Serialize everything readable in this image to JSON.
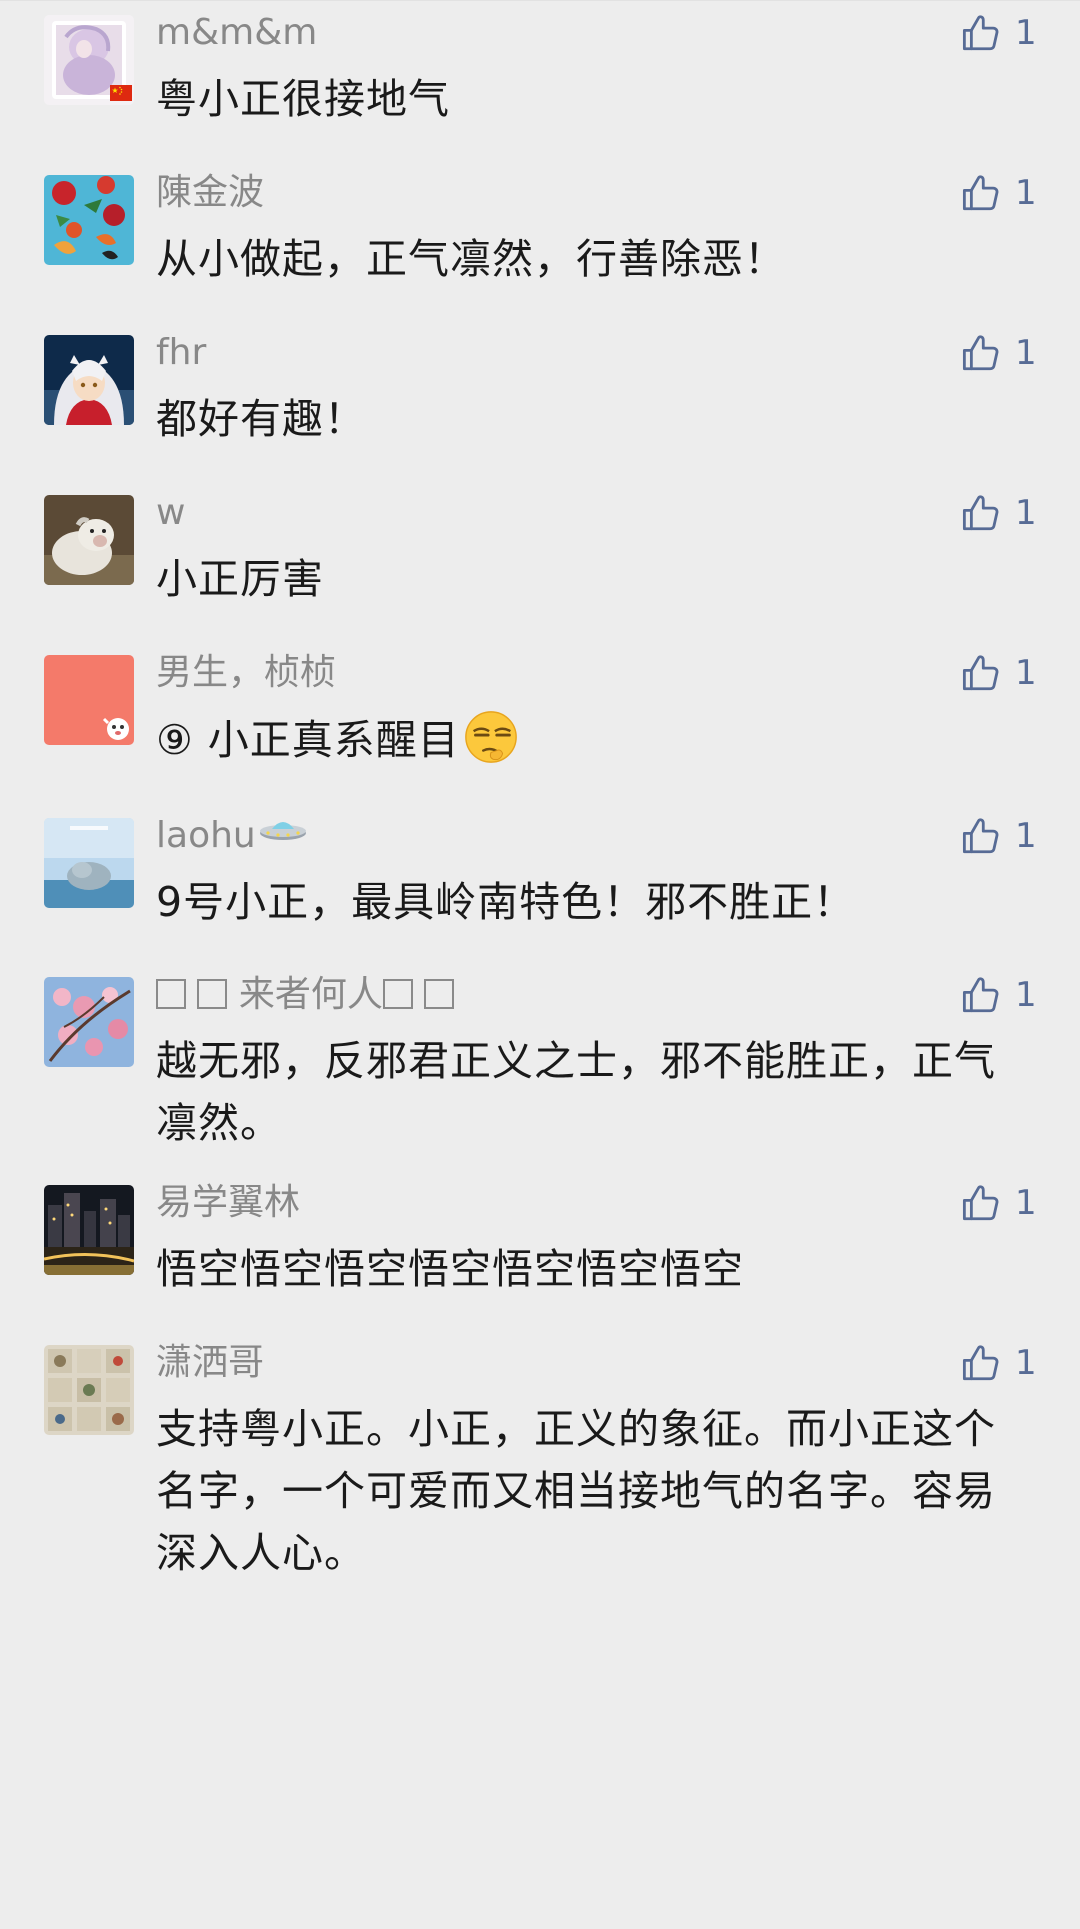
{
  "comments": [
    {
      "name": "m&m&m",
      "text": "粤小正很接地气",
      "likes": "1"
    },
    {
      "name": "陳金波",
      "text": "从小做起，正气凛然，行善除恶！",
      "likes": "1"
    },
    {
      "name": "fhr",
      "text": "都好有趣！",
      "likes": "1"
    },
    {
      "name": "w",
      "text": "小正厉害",
      "likes": "1"
    },
    {
      "name": "男生，桢桢",
      "text": "⑨ 小正真系醒目",
      "likes": "1"
    },
    {
      "name": "laohu",
      "text": "9号小正，最具岭南特色！邪不胜正！",
      "likes": "1"
    },
    {
      "name": "来者何人",
      "text": "越无邪，反邪君正义之士，邪不能胜正，正气凛然。",
      "likes": "1"
    },
    {
      "name": "易学翼林",
      "text": "悟空悟空悟空悟空悟空悟空悟空",
      "likes": "1"
    },
    {
      "name": "潇洒哥",
      "text": "支持粤小正。小正，正义的象征。而小正这个名字，一个可爱而又相当接地气的名字。容易深入人心。",
      "likes": "1"
    }
  ],
  "icons": {
    "like": "thumbs-up-icon",
    "emoji": "smirk-emoji-icon",
    "ufo": "flying-saucer-emoji-icon",
    "flag": "china-flag-icon"
  },
  "colors": {
    "background": "#ededed",
    "name": "#888888",
    "text": "#1a1a1a",
    "like": "#576b95",
    "salmon_avatar": "#f47a6a"
  }
}
